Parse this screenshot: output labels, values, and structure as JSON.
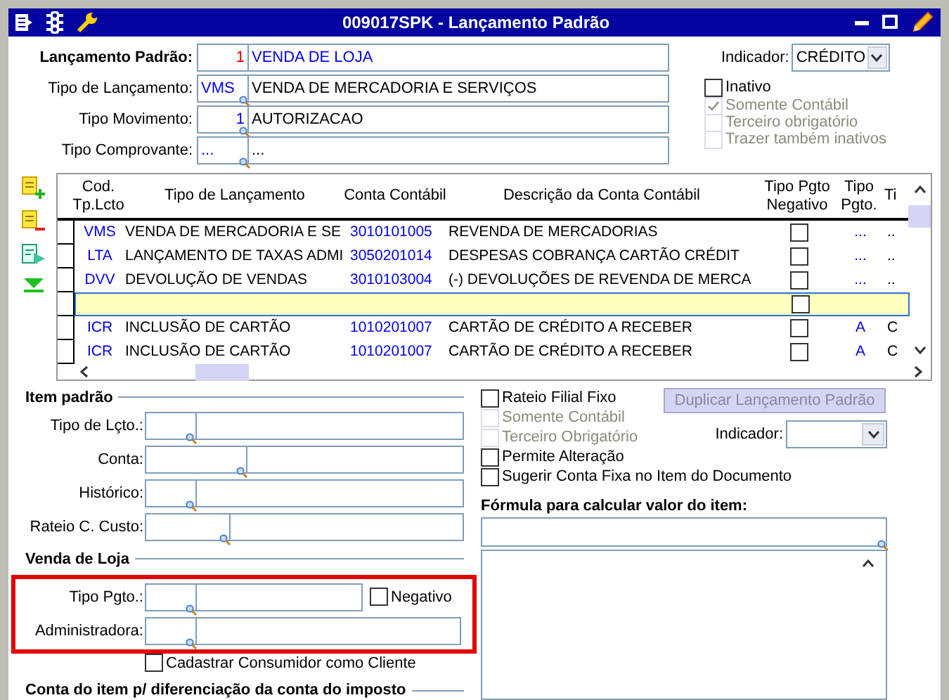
{
  "window": {
    "title": "009017SPK - Lançamento Padrão"
  },
  "header": {
    "fields": [
      {
        "label": "Lançamento Padrão:",
        "code": "1",
        "value": "VENDA DE LOJA",
        "kind": "main"
      },
      {
        "label": "Tipo de Lançamento:",
        "code": "VMS",
        "value": "VENDA DE MERCADORIA E SERVIÇOS",
        "kind": "lookup"
      },
      {
        "label": "Tipo Movimento:",
        "code": "1",
        "value": "AUTORIZACAO",
        "kind": "lookup-number"
      },
      {
        "label": "Tipo Comprovante:",
        "code": "...",
        "value": "...",
        "kind": "lookup"
      }
    ],
    "indicator": {
      "label": "Indicador:",
      "value": "CRÉDITO"
    },
    "checks": [
      {
        "label": "Inativo",
        "checked": false,
        "disabled": false
      },
      {
        "label": "Somente Contábil",
        "checked": true,
        "disabled": true
      },
      {
        "label": "Terceiro obrigatório",
        "checked": false,
        "disabled": true
      },
      {
        "label": "Trazer também inativos",
        "checked": false,
        "disabled": true
      }
    ]
  },
  "grid": {
    "columns": [
      "Cod.\nTp.Lcto",
      "Tipo de Lançamento",
      "Conta Contábil",
      "Descrição da Conta Contábil",
      "Tipo Pgto\nNegativo",
      "Tipo\nPgto.",
      "Ti"
    ],
    "rows": [
      {
        "code": "VMS",
        "type": "VENDA DE MERCADORIA E SE",
        "account": "3010101005",
        "description": "REVENDA DE MERCADORIAS",
        "negative": false,
        "payment": "...",
        "column_7": "..",
        "selected": false
      },
      {
        "code": "LTA",
        "type": "LANÇAMENTO DE TAXAS ADMI",
        "account": "3050201014",
        "description": "DESPESAS COBRANÇA CARTÃO CRÉDIT",
        "negative": false,
        "payment": "...",
        "column_7": "..",
        "selected": false
      },
      {
        "code": "DVV",
        "type": "DEVOLUÇÃO DE VENDAS",
        "account": "3010103004",
        "description": "(-) DEVOLUÇÕES DE REVENDA DE MERCA",
        "negative": false,
        "payment": "...",
        "column_7": "..",
        "selected": false
      },
      {
        "negative": false,
        "selected": true
      },
      {
        "code": "ICR",
        "type": "INCLUSÃO DE CARTÃO",
        "account": "1010201007",
        "description": "CARTÃO DE CRÉDITO A RECEBER",
        "negative": false,
        "payment": "A",
        "column_7": "C",
        "selected": false
      },
      {
        "code": "ICR",
        "type": "INCLUSÃO DE CARTÃO",
        "account": "1010201007",
        "description": "CARTÃO DE CRÉDITO A RECEBER",
        "negative": false,
        "payment": "A",
        "column_7": "C",
        "selected": false
      }
    ]
  },
  "item": {
    "title": "Item padrão",
    "fields": [
      {
        "label": "Tipo de Lçto.:"
      },
      {
        "label": "Conta:"
      },
      {
        "label": "Histórico:"
      },
      {
        "label": "Rateio C. Custo:"
      }
    ]
  },
  "store": {
    "title": "Venda de Loja",
    "payment_label": "Tipo Pgto.:",
    "negative": {
      "label": "Negativo",
      "checked": false
    },
    "admin_label": "Administradora:",
    "customer": {
      "label": "Cadastrar Consumidor como Cliente",
      "checked": false
    }
  },
  "tax": {
    "title": "Conta do item p/ diferenciação da conta do imposto"
  },
  "options": {
    "checks": [
      {
        "label": "Rateio Filial Fixo",
        "checked": false,
        "disabled": false
      },
      {
        "label": "Somente Contábil",
        "checked": false,
        "disabled": true
      },
      {
        "label": "Terceiro Obrigatório",
        "checked": false,
        "disabled": true
      },
      {
        "label": "Permite Alteração",
        "checked": false,
        "disabled": false
      },
      {
        "label": "Sugerir Conta Fixa no Item do Documento",
        "checked": false,
        "disabled": false
      }
    ],
    "duplicate_button": {
      "label": "Duplicar Lançamento Padrão",
      "disabled": true
    },
    "indicator_label": "Indicador:",
    "formula_title": "Fórmula para calcular valor do item:"
  }
}
